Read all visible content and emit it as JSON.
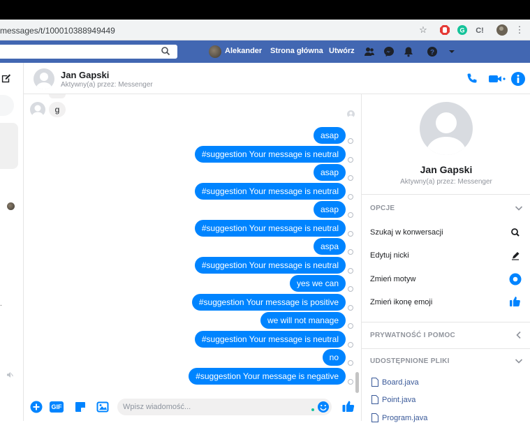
{
  "browser": {
    "url": "messages/t/100010388949449"
  },
  "facebook": {
    "user_name": "Alekander",
    "nav_home": "Strona główna",
    "nav_create": "Utwórz"
  },
  "chat": {
    "contact_name": "Jan Gapski",
    "contact_status": "Aktywny(a) przez: Messenger",
    "incoming_message": "g",
    "outgoing_messages": [
      "asap",
      "#suggestion Your message is neutral",
      "asap",
      "#suggestion Your message is neutral",
      "asap",
      "#suggestion Your message is neutral",
      "aspa",
      "#suggestion Your message is neutral",
      "yes we can",
      "#suggestion Your message is positive",
      "we will not manage",
      "#suggestion Your message is neutral",
      "no",
      "#suggestion Your message is negative"
    ],
    "composer_placeholder": "Wpisz wiadomość...",
    "gif_label": "GIF"
  },
  "details": {
    "name": "Jan Gapski",
    "status": "Aktywny(a) przez: Messenger",
    "options_title": "OPCJE",
    "options": [
      {
        "label": "Szukaj w konwersacji",
        "icon": "search-icon"
      },
      {
        "label": "Edytuj nicki",
        "icon": "pencil-icon"
      },
      {
        "label": "Zmień motyw",
        "icon": "theme-color-icon"
      },
      {
        "label": "Zmień ikonę emoji",
        "icon": "thumbs-up-icon"
      }
    ],
    "privacy_title": "PRYWATNOŚĆ I POMOC",
    "files_title": "UDOSTĘPNIONE PLIKI",
    "files": [
      "Board.java",
      "Point.java",
      "Program.java"
    ]
  },
  "colors": {
    "messenger_blue": "#0084ff",
    "facebook_blue": "#4267b2",
    "link_blue": "#385898"
  }
}
